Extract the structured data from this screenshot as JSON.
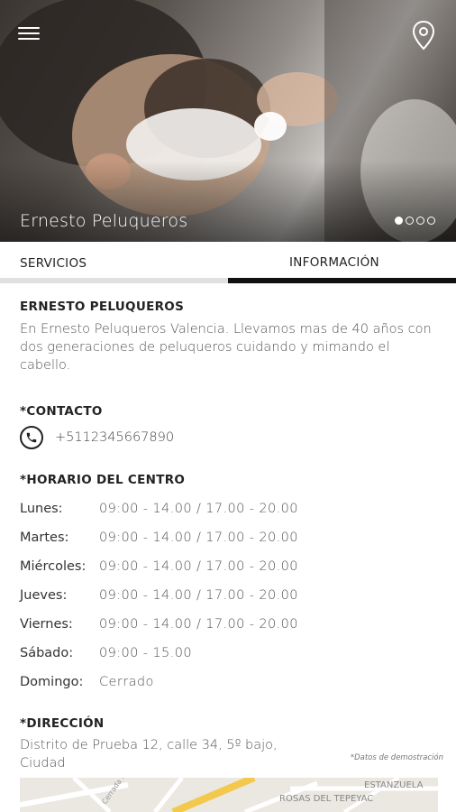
{
  "hero": {
    "title": "Ernesto Peluqueros",
    "slides_total": 4,
    "slide_active": 1
  },
  "tabs": [
    {
      "label": "SERVICIOS",
      "selected": false
    },
    {
      "label": "INFORMACIÓN",
      "selected": true
    }
  ],
  "about": {
    "title": "ERNESTO PELUQUEROS",
    "text": "En Ernesto Peluqueros Valencia. Llevamos mas de 40 años con dos generaciones de peluqueros cuidando y mimando el cabello."
  },
  "contact": {
    "title": "*CONTACTO",
    "phone": "+5112345667890",
    "icon": "phone-icon"
  },
  "schedule": {
    "title": "*HORARIO DEL CENTRO",
    "rows": [
      {
        "day": "Lunes:",
        "hours": "09:00 - 14.00  /  17.00 - 20.00"
      },
      {
        "day": "Martes:",
        "hours": "09:00 - 14.00  /  17.00 - 20.00"
      },
      {
        "day": "Miércoles:",
        "hours": "09:00 - 14.00  /  17.00 - 20.00"
      },
      {
        "day": "Jueves:",
        "hours": "09:00 - 14.00  /  17.00 - 20.00"
      },
      {
        "day": "Viernes:",
        "hours": "09:00 - 14.00  /  17.00 - 20.00"
      },
      {
        "day": "Sábado:",
        "hours": "09:00 - 15.00"
      },
      {
        "day": "Domingo:",
        "hours": "Cerrado"
      }
    ]
  },
  "address": {
    "title": "*DIRECCIÓN",
    "line1": "Distrito de Prueba 12, calle 34, 5º bajo,",
    "line2": "Ciudad",
    "demo_note": "*Datos de demostración"
  },
  "map": {
    "labels": [
      "ESTANZUELA",
      "ROSAS DEL TEPEYAC",
      "Cerrada Coquimbo"
    ]
  },
  "colors": {
    "accent": "#111111",
    "tab_inactive_bar": "#e0e0e0",
    "text_primary": "#222222",
    "text_secondary": "#555555",
    "map_road_highlight": "#f2c94c"
  }
}
